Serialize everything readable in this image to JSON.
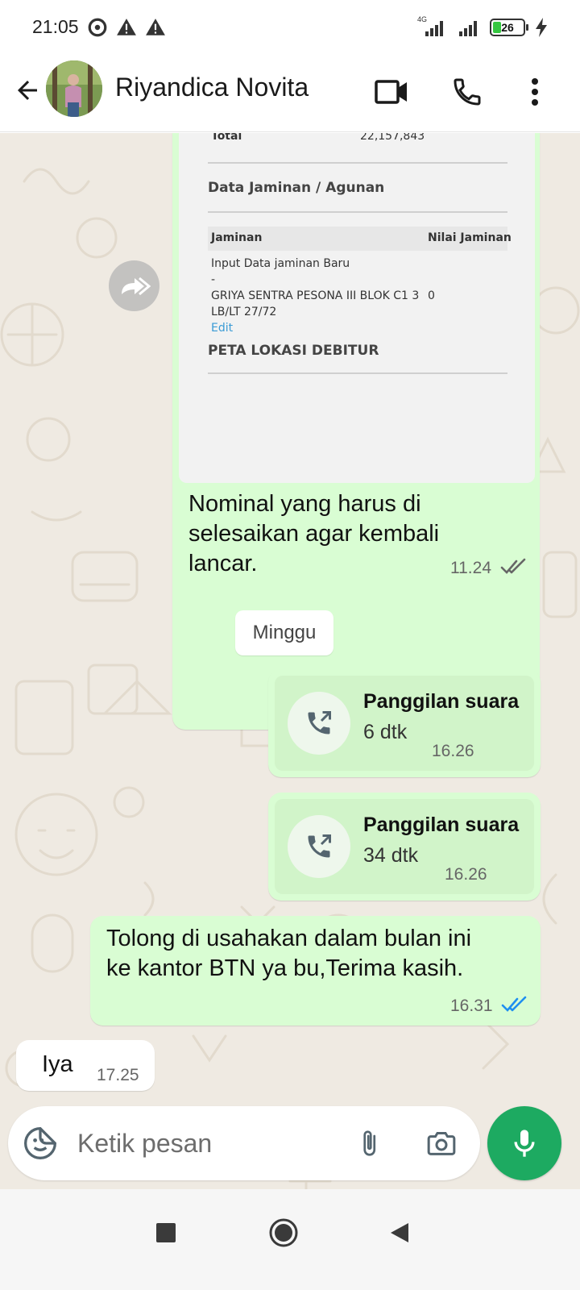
{
  "status_bar": {
    "time": "21:05",
    "network_label": "4G",
    "battery": "26"
  },
  "header": {
    "contact_name": "Riyandica Novita",
    "icons": [
      "back-arrow-icon",
      "video-call-icon",
      "phone-icon",
      "more-vert-icon"
    ]
  },
  "document_image": {
    "total_label": "Total",
    "total_value": "22,157,843",
    "section_title": "Data Jaminan / Agunan",
    "col_jaminan": "Jaminan",
    "col_nilai": "Nilai Jaminan",
    "row_line1": "Input Data jaminan Baru",
    "row_line2": "-",
    "row_line3": "GRIYA SENTRA PESONA III BLOK C1 3",
    "row_line4": "LB/LT 27/72",
    "row_value": "0",
    "row_edit": "Edit",
    "map_title": "PETA LOKASI DEBITUR"
  },
  "messages": [
    {
      "direction": "out",
      "type": "image",
      "caption_lines": [
        "Nominal yang harus di",
        "selesaikan agar kembali",
        "lancar."
      ],
      "time": "11.24",
      "status": "delivered"
    },
    {
      "type": "date_chip",
      "label": "Minggu"
    },
    {
      "direction": "out",
      "type": "call",
      "title": "Panggilan suara",
      "duration": "6 dtk",
      "time": "16.26"
    },
    {
      "direction": "out",
      "type": "call",
      "title": "Panggilan suara",
      "duration": "34 dtk",
      "time": "16.26"
    },
    {
      "direction": "out",
      "type": "text",
      "lines": [
        "Tolong di usahakan dalam bulan ini",
        "ke kantor BTN ya bu,Terima kasih."
      ],
      "time": "16.31",
      "status": "read"
    },
    {
      "direction": "in",
      "type": "text",
      "text": "Iya",
      "time": "17.25"
    }
  ],
  "composer": {
    "placeholder": "Ketik pesan",
    "value": ""
  },
  "colors": {
    "outgoing_bubble": "#d9fdd3",
    "incoming_bubble": "#ffffff",
    "chat_background": "#efeae2",
    "accent_green": "#1daa61",
    "read_tick": "#53bdeb"
  }
}
